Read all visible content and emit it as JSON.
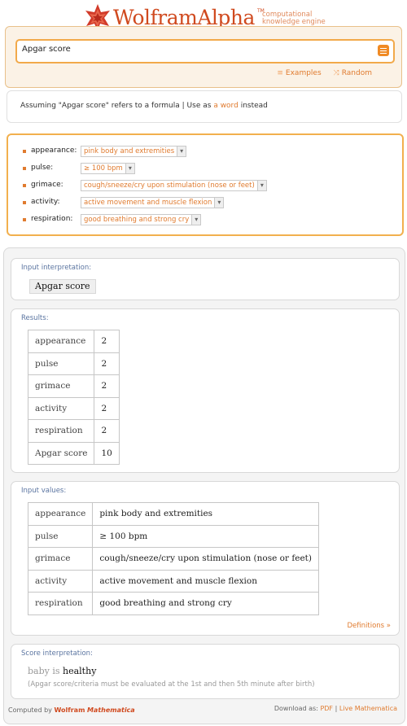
{
  "header": {
    "brand_wolfram": "Wolfram",
    "brand_alpha": "Alpha",
    "tagline_line1": "computational",
    "tagline_line2": "knowledge engine",
    "trademark": "TM"
  },
  "search": {
    "value": "Apgar score",
    "links": {
      "examples": "Examples",
      "random": "Random"
    }
  },
  "assumption": {
    "prefix": "Assuming \"Apgar score\" refers to a formula",
    "separator": "|",
    "use_as": "Use as",
    "alt_link": "a word",
    "suffix": "instead"
  },
  "parameters": [
    {
      "label": "appearance:",
      "value": "pink body and extremities"
    },
    {
      "label": "pulse:",
      "value": "≥ 100 bpm"
    },
    {
      "label": "grimace:",
      "value": "cough/sneeze/cry upon stimulation (nose or feet)"
    },
    {
      "label": "activity:",
      "value": "active movement and muscle flexion"
    },
    {
      "label": "respiration:",
      "value": "good breathing and strong cry"
    }
  ],
  "pods": {
    "input_interpretation": {
      "title": "Input interpretation:",
      "value": "Apgar score"
    },
    "results": {
      "title": "Results:",
      "rows": [
        [
          "appearance",
          "2"
        ],
        [
          "pulse",
          "2"
        ],
        [
          "grimace",
          "2"
        ],
        [
          "activity",
          "2"
        ],
        [
          "respiration",
          "2"
        ],
        [
          "Apgar score",
          "10"
        ]
      ]
    },
    "input_values": {
      "title": "Input values:",
      "rows": [
        [
          "appearance",
          "pink body and extremities"
        ],
        [
          "pulse",
          "≥ 100 bpm"
        ],
        [
          "grimace",
          "cough/sneeze/cry upon stimulation (nose or feet)"
        ],
        [
          "activity",
          "active movement and muscle flexion"
        ],
        [
          "respiration",
          "good breathing and strong cry"
        ]
      ],
      "definitions_link": "Definitions »"
    },
    "score_interpretation": {
      "title": "Score interpretation:",
      "prefix": "baby is",
      "value": "healthy",
      "note": "(Apgar score/criteria must be evaluated at the 1st and then 5th minute after birth)"
    }
  },
  "footer": {
    "computed_by": "Computed by",
    "wolfram": "Wolfram",
    "mathematica": "Mathematica",
    "download_as": "Download as:",
    "pdf": "PDF",
    "sep": "|",
    "live": "Live Mathematica"
  },
  "colors": {
    "brand": "#d04a1f",
    "accent": "#e07b2f",
    "border_orange": "#f2a94a",
    "pod_title": "#5a74a0"
  }
}
